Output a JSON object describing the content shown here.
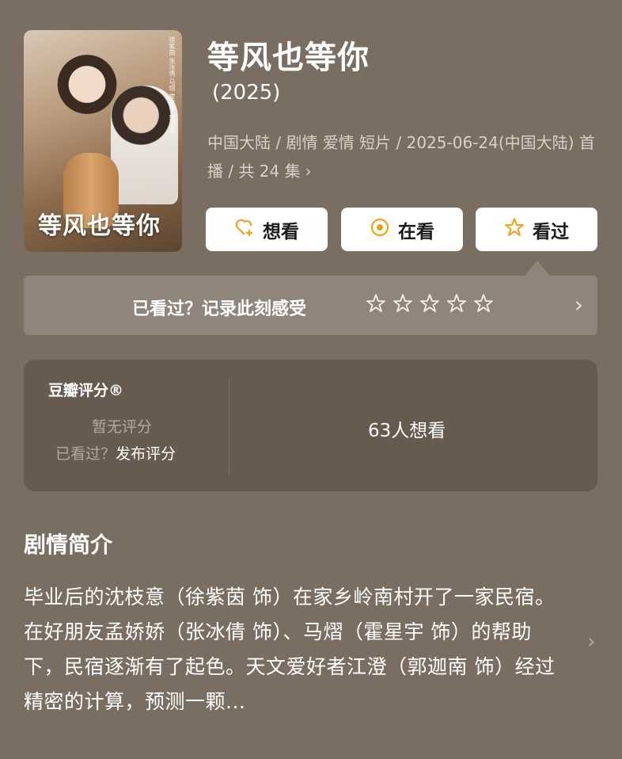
{
  "poster": {
    "title_text": "等风也等你",
    "credits": "徐紫茵 张冰倩 马熠 霍星宇 郭迦南"
  },
  "movie": {
    "title": "等风也等你",
    "year": "(2025)",
    "meta": "中国大陆 / 剧情 爱情 短片 / 2025-06-24(中国大陆) 首播 / 共 24 集"
  },
  "actions": {
    "want": {
      "label": "想看",
      "icon": "heart-plus-icon"
    },
    "watching": {
      "label": "在看",
      "icon": "target-circle-icon"
    },
    "watched": {
      "label": "看过",
      "icon": "star-outline-icon"
    }
  },
  "record": {
    "text": "已看过？记录此刻感受",
    "stars": 5,
    "icon": "chevron-right-icon"
  },
  "rating": {
    "label": "豆瓣评分®",
    "no_rating": "暂无评分",
    "watched_question": "已看过？",
    "publish": "发布评分",
    "want_count": "63人想看"
  },
  "synopsis": {
    "title": "剧情简介",
    "text": "毕业后的沈枝意（徐紫茵 饰）在家乡岭南村开了一家民宿。在好朋友孟娇娇（张冰倩 饰）、马熠（霍星宇 饰）的帮助下，民宿逐渐有了起色。天文爱好者江澄（郭迦南 饰）经过精密的计算，预测一颗..."
  },
  "colors": {
    "background": "#7a6e62",
    "card": "#675b50",
    "record_bar": "#8f857b",
    "accent_orange": "#f0a020"
  }
}
